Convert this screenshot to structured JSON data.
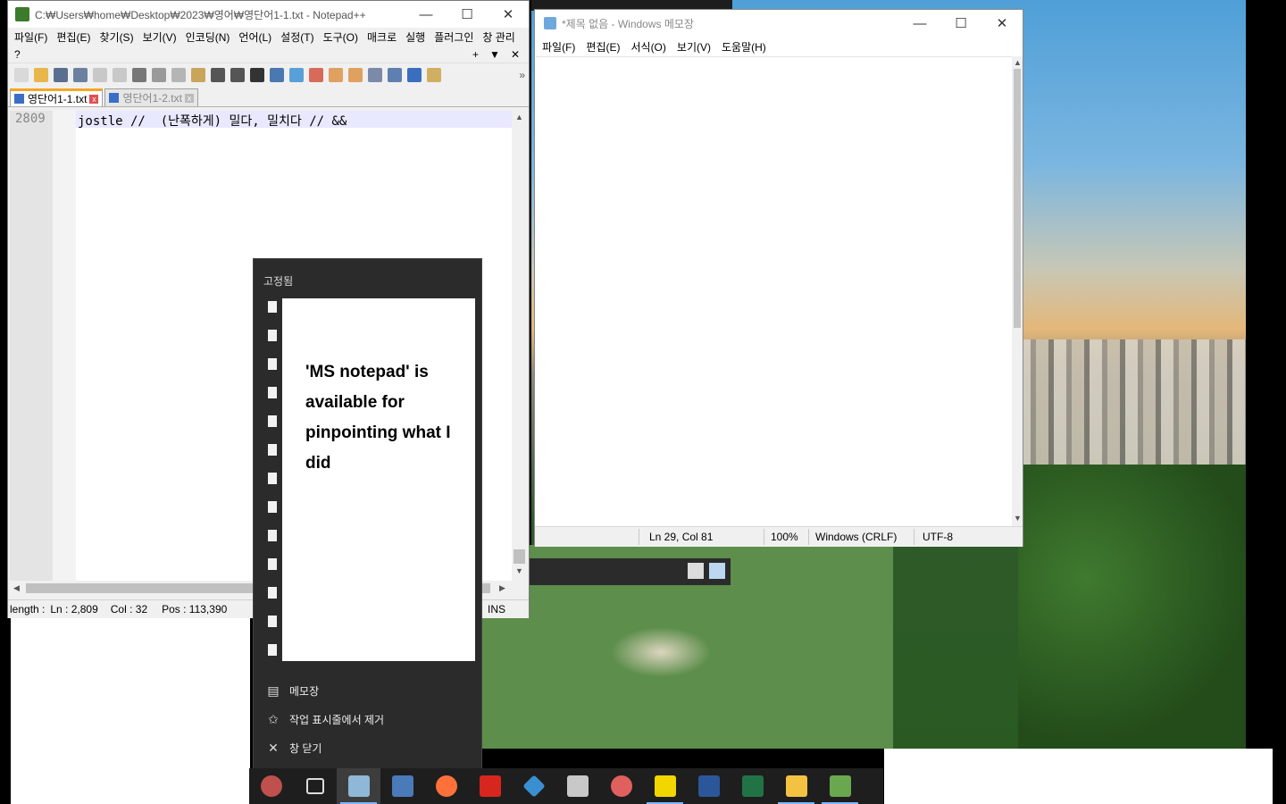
{
  "notepadpp": {
    "title": "C:₩Users₩home₩Desktop₩2023₩영어₩영단어1-1.txt - Notepad++",
    "menu_row1": [
      "파일(F)",
      "편집(E)",
      "찾기(S)",
      "보기(V)",
      "인코딩(N)",
      "언어(L)",
      "설정(T)",
      "도구(O)",
      "매크로",
      "실행"
    ],
    "menu_row2": [
      "플러그인",
      "창 관리",
      "?"
    ],
    "menu_extra": [
      "+",
      "▼",
      "✕"
    ],
    "tabs": [
      {
        "label": "영단어1-1.txt",
        "active": true
      },
      {
        "label": "영단어1-2.txt",
        "active": false
      }
    ],
    "line_number": "2809",
    "line_text": "jostle //  (난폭하게) 밀다, 밀치다 // &&",
    "status": {
      "length": "length :",
      "ln": "Ln : 2,809",
      "col": "Col : 32",
      "pos": "Pos : 113,390",
      "mode": "INS"
    }
  },
  "notepad": {
    "title": "*제목 없음 - Windows 메모장",
    "menu": [
      "파일(F)",
      "편집(E)",
      "서식(O)",
      "보기(V)",
      "도움말(H)"
    ],
    "status": {
      "position": "Ln 29, Col 81",
      "zoom": "100%",
      "line_ending": "Windows (CRLF)",
      "encoding": "UTF-8"
    }
  },
  "jumplist": {
    "heading": "고정됨",
    "note": "'MS notepad' is available for pinpointing what I did",
    "actions": [
      {
        "label": "메모장",
        "icon": "notepad-icon"
      },
      {
        "label": "작업 표시줄에서 제거",
        "icon": "unpin-icon"
      },
      {
        "label": "창 닫기",
        "icon": "close-icon"
      }
    ]
  },
  "taskbar": {
    "apps": [
      {
        "name": "custom-app-icon",
        "color": "#c0504d"
      },
      {
        "name": "task-view-icon",
        "color": "#1e1e1e"
      },
      {
        "name": "notepad-icon",
        "color": "#8fb8d8"
      },
      {
        "name": "calculator-icon",
        "color": "#4a7ab8"
      },
      {
        "name": "firefox-icon",
        "color": "#ff7139"
      },
      {
        "name": "acrobat-icon",
        "color": "#d7261e"
      },
      {
        "name": "network-tool-icon",
        "color": "#3a8fd0"
      },
      {
        "name": "mail-icon",
        "color": "#c8c8c8"
      },
      {
        "name": "paint-icon",
        "color": "#e06060"
      },
      {
        "name": "sticky-notes-icon",
        "color": "#f2d600"
      },
      {
        "name": "word-icon",
        "color": "#2b579a"
      },
      {
        "name": "excel-icon",
        "color": "#217346"
      },
      {
        "name": "file-explorer-icon",
        "color": "#f4c242"
      },
      {
        "name": "notepadpp-icon",
        "color": "#6aa84f"
      }
    ]
  }
}
